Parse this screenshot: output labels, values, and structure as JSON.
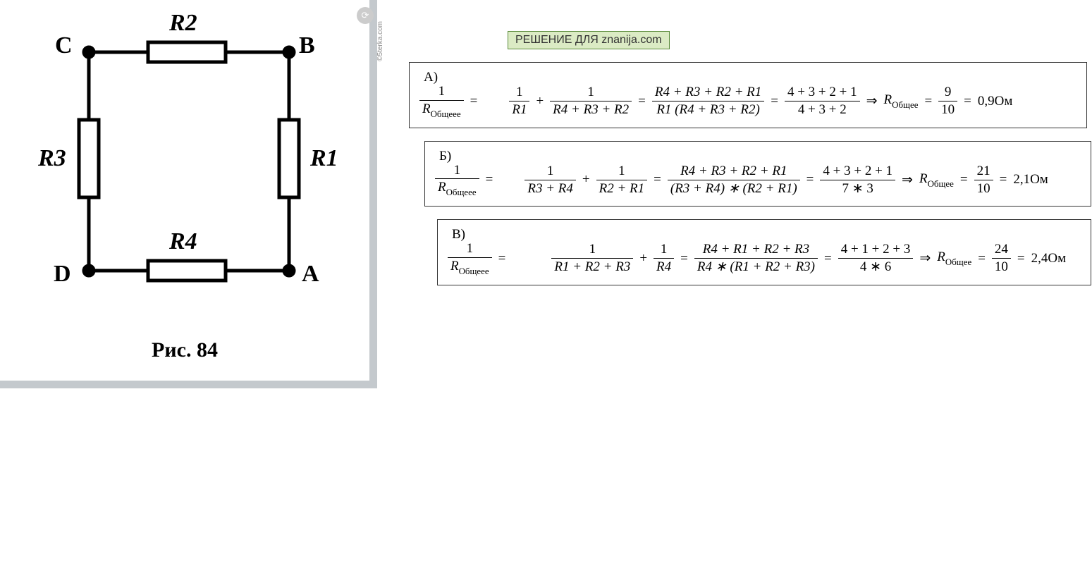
{
  "figure": {
    "caption": "Рис. 84",
    "nodes": {
      "C": "C",
      "B": "B",
      "D": "D",
      "A": "A"
    },
    "resistors": {
      "R1": "R1",
      "R2": "R2",
      "R3": "R3",
      "R4": "R4"
    },
    "watermark_text": "©5terka.com"
  },
  "solution_header": "РЕШЕНИЕ ДЛЯ znanija.com",
  "common": {
    "R_total_symbol": "R",
    "R_total_sub_lhs": "Общеее",
    "R_total_sub": "Общее",
    "unit": "Ом",
    "eq": "=",
    "plus": "+",
    "arrow": "⇒"
  },
  "eqA": {
    "tag": "А)",
    "lhs_num": "1",
    "t1_num": "1",
    "t1_den": "R1",
    "t2_num": "1",
    "t2_den": "R4 + R3 + R2",
    "comb_num": "R4 + R3 + R2 + R1",
    "comb_den": "R1 (R4 + R3 + R2)",
    "numsum": "4 + 3 + 2 + 1",
    "densum": "4 + 3 + 2",
    "res_num": "9",
    "res_den": "10",
    "res_val": "0,9"
  },
  "eqB": {
    "tag": "Б)",
    "lhs_num": "1",
    "t1_num": "1",
    "t1_den": "R3 + R4",
    "t2_num": "1",
    "t2_den": "R2 + R1",
    "comb_num": "R4 + R3 + R2 + R1",
    "comb_den": "(R3 + R4) ∗ (R2 + R1)",
    "numsum": "4 + 3 + 2 + 1",
    "densum": "7 ∗ 3",
    "res_num": "21",
    "res_den": "10",
    "res_val": "2,1"
  },
  "eqC": {
    "tag": "В)",
    "lhs_num": "1",
    "t1_num": "1",
    "t1_den": "R1 + R2 + R3",
    "t2_num": "1",
    "t2_den": "R4",
    "comb_num": "R4 + R1 + R2 + R3",
    "comb_den": "R4 ∗ (R1 + R2 + R3)",
    "numsum": "4 + 1 + 2 + 3",
    "densum": "4 ∗ 6",
    "res_num": "24",
    "res_den": "10",
    "res_val": "2,4"
  }
}
